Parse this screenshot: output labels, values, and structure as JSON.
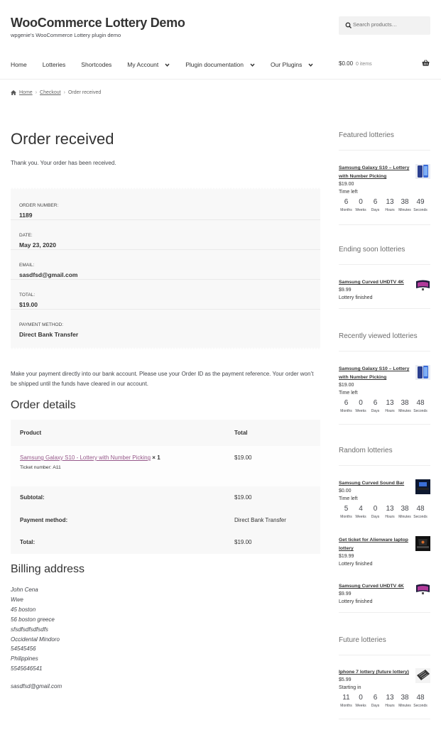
{
  "site": {
    "title": "WooCommerce Lottery Demo",
    "description": "wpgenie's WooCommerce Lottery plugin demo"
  },
  "search": {
    "placeholder": "Search products…"
  },
  "nav": {
    "home": "Home",
    "lotteries": "Lotteries",
    "shortcodes": "Shortcodes",
    "my_account": "My Account",
    "plugin_docs": "Plugin documentation",
    "our_plugins": "Our Plugins"
  },
  "cart": {
    "amount": "$0.00",
    "items": "0 items"
  },
  "breadcrumb": {
    "home": "Home",
    "checkout": "Checkout",
    "current": "Order received",
    "sep": "›"
  },
  "main": {
    "title": "Order received",
    "thanks": "Thank you. Your order has been received.",
    "overview": {
      "order_number_label": "ORDER NUMBER:",
      "order_number": "1189",
      "date_label": "DATE:",
      "date": "May 23, 2020",
      "email_label": "EMAIL:",
      "email": "sasdfsd@gmail.com",
      "total_label": "TOTAL:",
      "total": "$19.00",
      "payment_label": "PAYMENT METHOD:",
      "payment": "Direct Bank Transfer"
    },
    "bank_note": "Make your payment directly into our bank account. Please use your Order ID as the payment reference. Your order won’t be shipped until the funds have cleared in our account.",
    "order_details_title": "Order details",
    "table": {
      "col_product": "Product",
      "col_total": "Total",
      "item_name": "Samsung Galaxy S10 - Lottery with Number Picking",
      "item_qty": " × 1",
      "ticket": "Ticket number: A11",
      "item_total": "$19.00",
      "subtotal_label": "Subtotal:",
      "subtotal": "$19.00",
      "payment_label": "Payment method:",
      "payment": "Direct Bank Transfer",
      "total_label": "Total:",
      "total": "$19.00"
    },
    "billing_title": "Billing address",
    "billing": {
      "l1": "John Cena",
      "l2": "Wwe",
      "l3": "45 boston",
      "l4": "56 boston greece",
      "l5": "sfsdfsdfsdfsdfs",
      "l6": "Occidental Mindoro",
      "l7": "54545456",
      "l8": "Philippines",
      "l9": "5545646541",
      "email": "sasdfsd@gmail.com"
    }
  },
  "sidebar": {
    "units": {
      "months": "Months",
      "weeks": "Weeks",
      "days": "Days",
      "hours": "Hours",
      "minutes": "Minutes",
      "seconds": "Seconds"
    },
    "featured": {
      "title": "Featured lotteries",
      "name": "Samsung Galaxy S10 – Lottery with Number Picking",
      "price": "$19.00",
      "status": "Time left",
      "cd": {
        "months": "6",
        "weeks": "0",
        "days": "6",
        "hours": "13",
        "minutes": "38",
        "seconds": "49"
      }
    },
    "ending": {
      "title": "Ending soon lotteries",
      "name": "Samsung Curved UHDTV 4K",
      "price": "$9.99",
      "status": "Lottery finished"
    },
    "recent": {
      "title": "Recently viewed lotteries",
      "name": "Samsung Galaxy S10 – Lottery with Number Picking",
      "price": "$19.00",
      "status": "Time left",
      "cd": {
        "months": "6",
        "weeks": "0",
        "days": "6",
        "hours": "13",
        "minutes": "38",
        "seconds": "48"
      }
    },
    "random": {
      "title": "Random lotteries",
      "a_name": "Samsung Curved Sound Bar",
      "a_price": "$0.00",
      "a_status": "Time left",
      "a_cd": {
        "months": "5",
        "weeks": "4",
        "days": "0",
        "hours": "13",
        "minutes": "38",
        "seconds": "48"
      },
      "b_name": "Get ticket for Alienware laptop lottery",
      "b_price": "$19.99",
      "b_status": "Lottery finished",
      "c_name": "Samsung Curved UHDTV 4K",
      "c_price": "$9.99",
      "c_status": "Lottery finished"
    },
    "future": {
      "title": "Future lotteries",
      "name": "Iphone 7 lottery (future lottery)",
      "price": "$5.99",
      "status": "Starting in",
      "cd": {
        "months": "11",
        "weeks": "0",
        "days": "6",
        "hours": "13",
        "minutes": "38",
        "seconds": "48"
      }
    }
  }
}
